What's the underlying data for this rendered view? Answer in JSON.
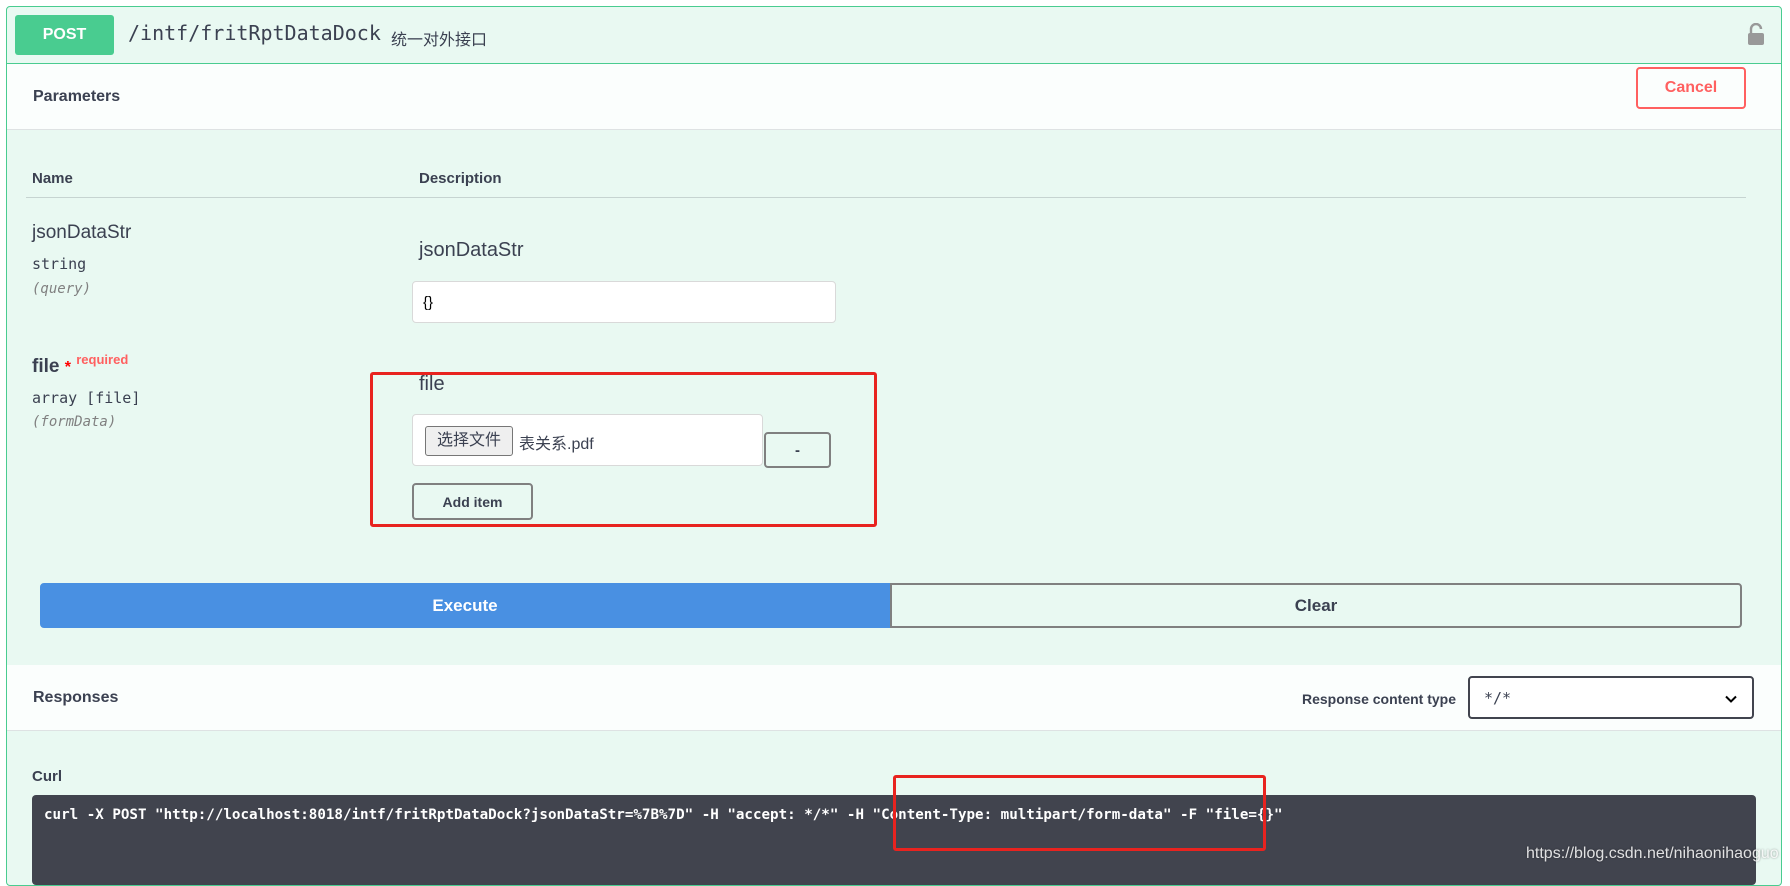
{
  "summary": {
    "method": "POST",
    "path": "/intf/fritRptDataDock",
    "description": "统一对外接口"
  },
  "parameters": {
    "title": "Parameters",
    "cancel_label": "Cancel",
    "col_name": "Name",
    "col_description": "Description",
    "items": [
      {
        "name": "jsonDataStr",
        "type": "string",
        "in": "(query)",
        "label": "jsonDataStr",
        "value": "{}"
      },
      {
        "name": "file",
        "required_star": "*",
        "required_text": "required",
        "type": "array [file]",
        "in": "(formData)",
        "label": "file",
        "choose_label": "选择文件",
        "file_name": "表关系.pdf",
        "remove_label": "-",
        "add_label": "Add item"
      }
    ]
  },
  "actions": {
    "execute_label": "Execute",
    "clear_label": "Clear"
  },
  "responses": {
    "title": "Responses",
    "content_type_label": "Response content type",
    "content_type_value": "*/*",
    "curl_label": "Curl",
    "curl_command": "curl -X POST \"http://localhost:8018/intf/fritRptDataDock?jsonDataStr=%7B%7D\" -H \"accept: */*\" -H \"Content-Type: multipart/form-data\" -F \"file={}\""
  },
  "watermark": "https://blog.csdn.net/nihaonihaoguo",
  "colors": {
    "method_post": "#49cc90",
    "execute": "#4990e2",
    "cancel": "#ff6060",
    "annotation_red": "#e8231f",
    "curl_bg": "#41444e"
  }
}
